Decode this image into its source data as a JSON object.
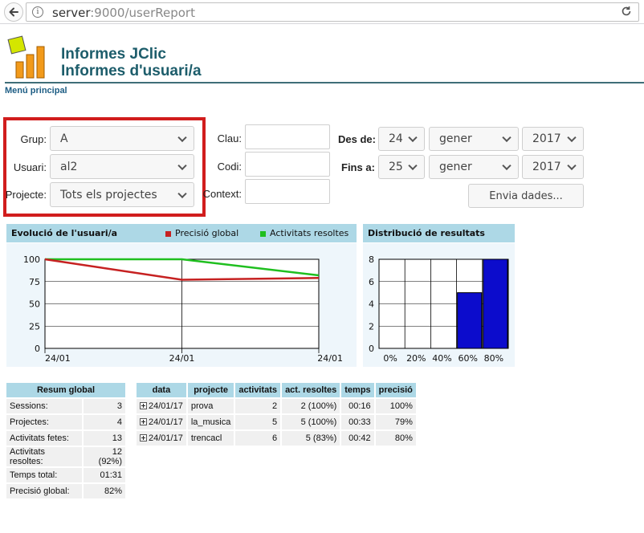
{
  "browser": {
    "url_host": "server",
    "url_rest": ":9000/userReport"
  },
  "header": {
    "title": "Informes JClic",
    "subtitle": "Informes d'usuari/a",
    "menu_link": "Menú principal"
  },
  "form": {
    "group_label": "Grup:",
    "group_value": "A",
    "user_label": "Usuari:",
    "user_value": "al2",
    "project_label": "Projecte:",
    "project_value": "Tots els projectes",
    "key_label": "Clau:",
    "key_value": "",
    "code_label": "Codi:",
    "code_value": "",
    "context_label": "Context:",
    "context_value": "",
    "from_label": "Des de:",
    "from_day": "24",
    "from_month": "gener",
    "from_year": "2017",
    "to_label": "Fins a:",
    "to_day": "25",
    "to_month": "gener",
    "to_year": "2017",
    "submit_label": "Envia dades..."
  },
  "colors": {
    "accent": "#add8e6",
    "highlight_box": "#d11d1d",
    "series_global": "#c62121",
    "series_solved": "#1fbf1f",
    "bar_fill": "#0c0ccc"
  },
  "chart_data": [
    {
      "type": "line",
      "title": "Evolució de l'usuari/a",
      "x": [
        "24/01",
        "24/01",
        "24/01"
      ],
      "series": [
        {
          "name": "Precisió global",
          "values": [
            100,
            77,
            79
          ]
        },
        {
          "name": "Activitats resoltes",
          "values": [
            100,
            100,
            82
          ]
        }
      ],
      "yticks": [
        0,
        25,
        50,
        75,
        100
      ],
      "ylim": [
        0,
        100
      ],
      "grid": true,
      "legend": "top-right"
    },
    {
      "type": "bar",
      "title": "Distribució de resultats",
      "categories": [
        "0%",
        "20%",
        "40%",
        "60%",
        "80%"
      ],
      "values": [
        0,
        0,
        0,
        5,
        8
      ],
      "yticks": [
        0,
        2,
        4,
        6,
        8
      ],
      "ylim": [
        0,
        8
      ],
      "grid": true
    }
  ],
  "summary": {
    "header": "Resum global",
    "rows": [
      {
        "label": "Sessions:",
        "value": "3"
      },
      {
        "label": "Projectes:",
        "value": "4"
      },
      {
        "label": "Activitats fetes:",
        "value": "13"
      },
      {
        "label": "Activitats resoltes:",
        "value": "12 (92%)"
      },
      {
        "label": "Temps total:",
        "value": "01:31"
      },
      {
        "label": "Precisió global:",
        "value": "82%"
      }
    ]
  },
  "sessions": {
    "columns": [
      "data",
      "projecte",
      "activitats",
      "act. resoltes",
      "temps",
      "precisió"
    ],
    "rows": [
      {
        "data": "24/01/17",
        "projecte": "prova",
        "activitats": "2",
        "resoltes": "2 (100%)",
        "temps": "00:16",
        "precisio": "100%"
      },
      {
        "data": "24/01/17",
        "projecte": "la_musica",
        "activitats": "5",
        "resoltes": "5 (100%)",
        "temps": "00:33",
        "precisio": "79%"
      },
      {
        "data": "24/01/17",
        "projecte": "trencacl",
        "activitats": "6",
        "resoltes": "5 (83%)",
        "temps": "00:42",
        "precisio": "80%"
      }
    ]
  }
}
